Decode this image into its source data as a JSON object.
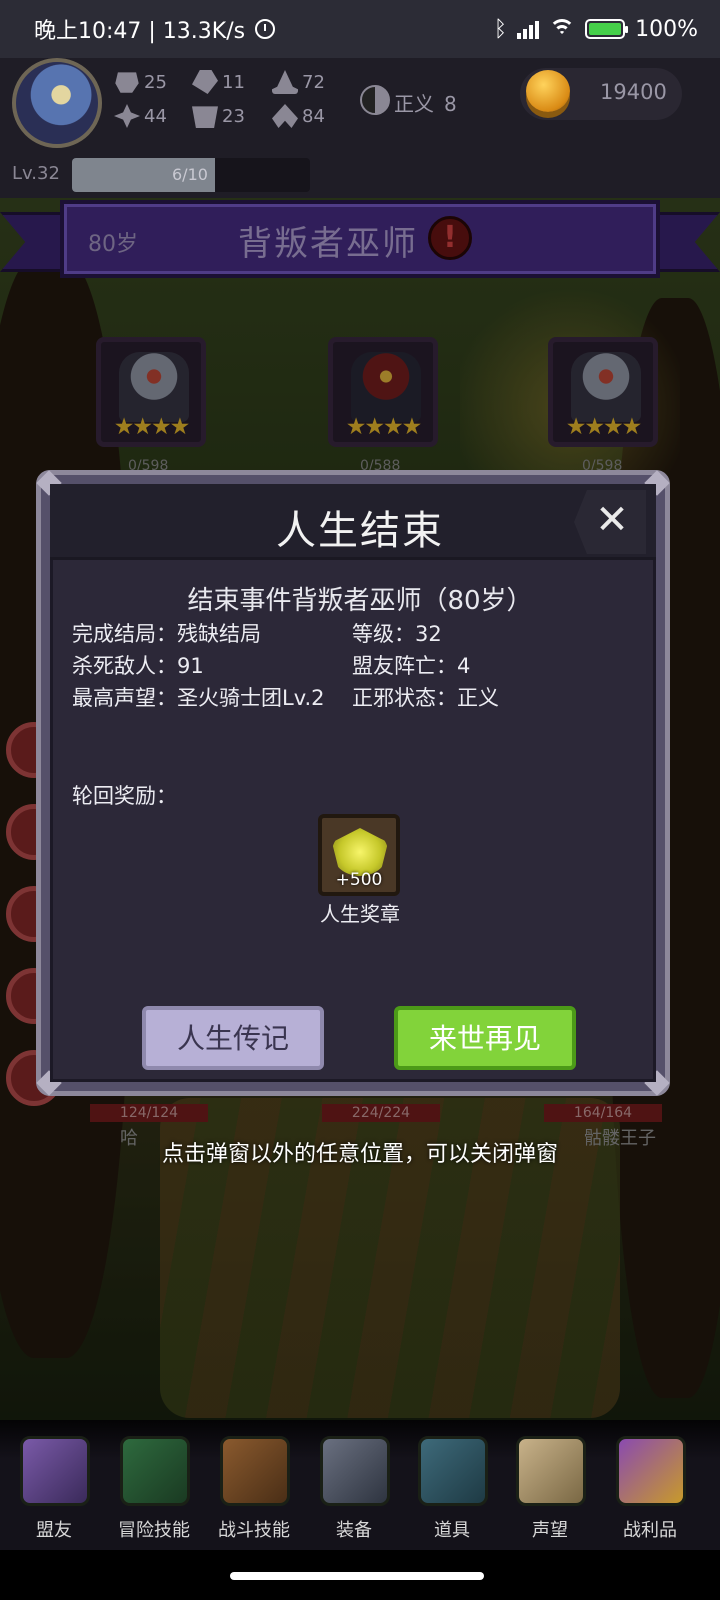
{
  "status_bar": {
    "time": "晚上10:47 | 13.3K/s",
    "battery": "100%"
  },
  "header": {
    "stats": {
      "power": "25",
      "agility": "11",
      "magic": "72",
      "luck": "44",
      "defense": "23",
      "spirit": "84"
    },
    "alignment_label": "正义",
    "alignment_value": "8",
    "coins": "19400",
    "level": "Lv.32",
    "xp_text": "6/10",
    "xp_progress": 0.6
  },
  "banner": {
    "age": "80岁",
    "title": "背叛者巫师"
  },
  "enemies": [
    {
      "count": "0/598",
      "stars": "★★★★"
    },
    {
      "count": "0/588",
      "stars": "★★★★"
    },
    {
      "count": "0/598",
      "stars": "★★★★"
    }
  ],
  "hp_labels": [
    "124/124",
    "224/224",
    "164/164"
  ],
  "enemy_names_partial": [
    "哈",
    "骷髅王子"
  ],
  "modal": {
    "title": "人生结束",
    "subtitle": "结束事件背叛者巫师（80岁）",
    "rows": [
      {
        "left": "完成结局：残缺结局",
        "right": "等级：32"
      },
      {
        "left": "杀死敌人：91",
        "right": "盟友阵亡：4"
      },
      {
        "left": "最高声望：圣火骑士团Lv.2",
        "right": "正邪状态：正义"
      }
    ],
    "reward_label": "轮回奖励：",
    "reward_amount": "+500",
    "reward_name": "人生奖章",
    "button_bio": "人生传记",
    "button_next": "来世再见"
  },
  "hint": "点击弹窗以外的任意位置，可以关闭弹窗",
  "bottom_nav": [
    "盟友",
    "冒险技能",
    "战斗技能",
    "装备",
    "道具",
    "声望",
    "战利品"
  ]
}
